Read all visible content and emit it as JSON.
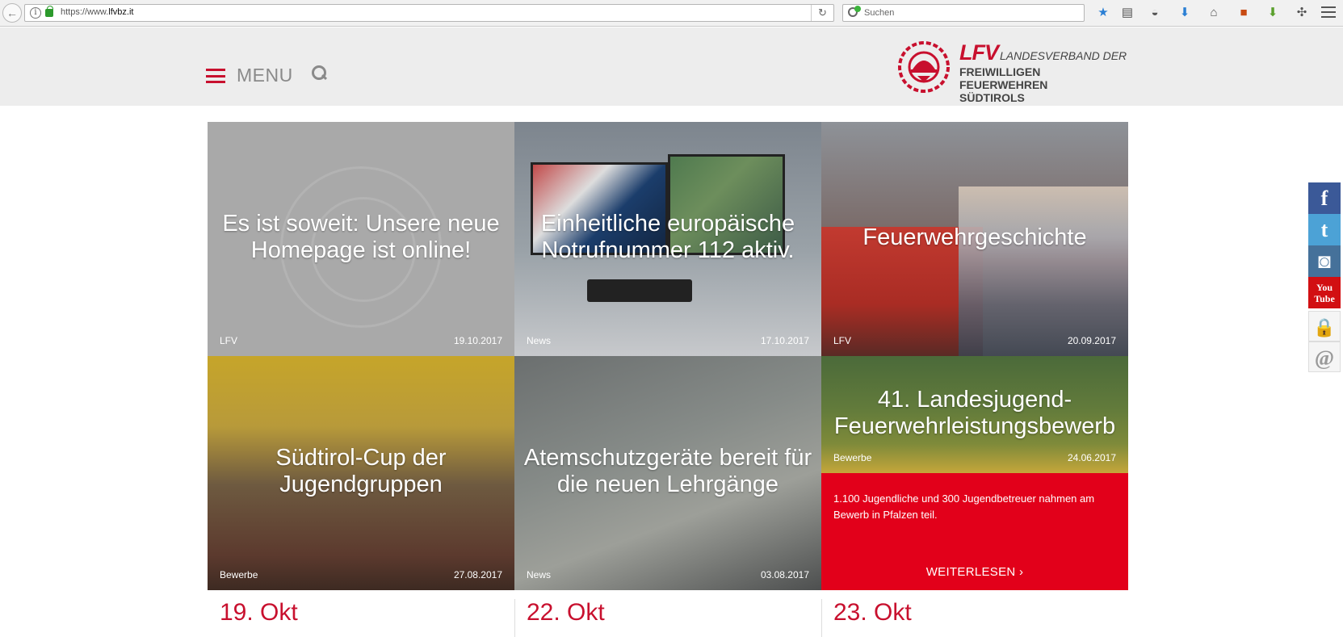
{
  "browser": {
    "url_prefix": "https://www.",
    "url_domain": "lfvbz.it",
    "search_placeholder": "Suchen"
  },
  "header": {
    "menu_label": "MENU",
    "logo": {
      "lfv": "LFV",
      "line1": "LANDESVERBAND DER",
      "line2": "FREIWILLIGEN FEUERWEHREN",
      "line3": "SÜDTIROLS"
    }
  },
  "tiles": [
    {
      "title": "Es ist soweit: Unsere neue Homepage ist online!",
      "category": "LFV",
      "date": "19.10.2017"
    },
    {
      "title": "Einheitliche europäische Notrufnummer 112 aktiv.",
      "category": "News",
      "date": "17.10.2017"
    },
    {
      "title": "Feuerwehrgeschichte",
      "category": "LFV",
      "date": "20.09.2017"
    },
    {
      "title": "Südtirol-Cup der Jugendgruppen",
      "category": "Bewerbe",
      "date": "27.08.2017"
    },
    {
      "title": "Atemschutzgeräte bereit für die neuen Lehrgänge",
      "category": "News",
      "date": "03.08.2017"
    },
    {
      "title": "41. Landesjugend-Feuerwehrleistungsbewerb",
      "category": "Bewerbe",
      "date": "24.06.2017",
      "teaser": "1.100 Jugendliche und 300 Jugendbetreuer nahmen am Bewerb in Pfalzen teil.",
      "readmore": "WEITERLESEN"
    }
  ],
  "events": [
    {
      "date": "19. Okt"
    },
    {
      "date": "22. Okt"
    },
    {
      "date": "23. Okt"
    }
  ],
  "social": {
    "facebook": "f",
    "twitter": "t",
    "instagram": "◙",
    "youtube": "You Tube",
    "login": "🔒",
    "contact": "@"
  },
  "colors": {
    "brand_red": "#c8102e",
    "teaser_red": "#e2001a",
    "header_bg": "#ededed"
  }
}
